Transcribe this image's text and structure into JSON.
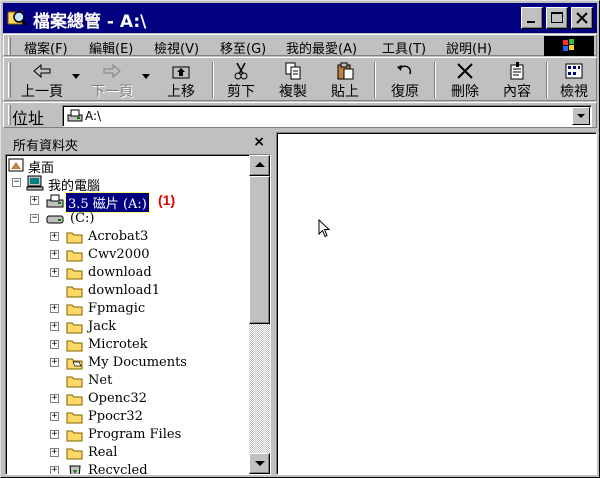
{
  "window": {
    "title": "檔案總管 - A:\\"
  },
  "menu": {
    "items": [
      "檔案(F)",
      "編輯(E)",
      "檢視(V)",
      "移至(G)",
      "我的最愛(A)",
      "工具(T)",
      "說明(H)"
    ]
  },
  "toolbar": {
    "back": "上一頁",
    "forward": "下一頁",
    "up": "上移",
    "cut": "剪下",
    "copy": "複製",
    "paste": "貼上",
    "undo": "復原",
    "delete": "刪除",
    "properties": "內容",
    "views": "檢視"
  },
  "address": {
    "label": "位址",
    "value": "A:\\"
  },
  "panel": {
    "title": "所有資料夾",
    "close": "×"
  },
  "tree": {
    "desktop": "桌面",
    "my_computer": "我的電腦",
    "floppy": "3.5 磁片 (A:)",
    "drive_c": "(C:)",
    "folders": [
      "Acrobat3",
      "Cwv2000",
      "download",
      "download1",
      "Fpmagic",
      "Jack",
      "Microtek",
      "My Documents",
      "Net",
      "Openc32",
      "Ppocr32",
      "Program Files",
      "Real",
      "Recycled"
    ],
    "annotation": "(1)"
  },
  "colors": {
    "titlebar": "#000080",
    "face": "#c0c0c0",
    "annotation": "#e00000"
  }
}
